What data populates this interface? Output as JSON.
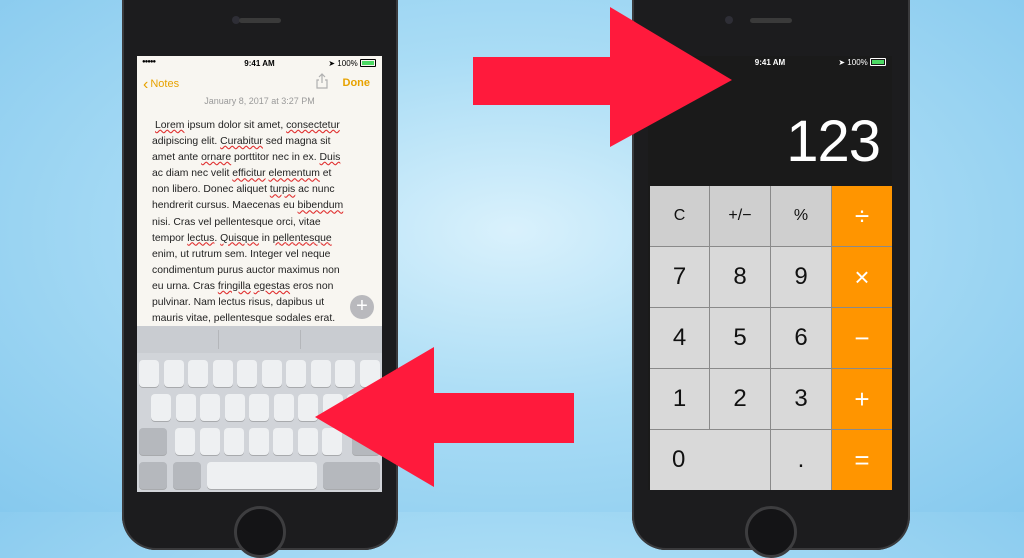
{
  "notes": {
    "status": {
      "time": "9:41 AM",
      "battery": "100%"
    },
    "nav": {
      "back_label": "Notes",
      "done_label": "Done"
    },
    "date": "January 8, 2017 at 3:27 PM",
    "lines": [
      [
        "Lorem",
        " ipsum dolor sit amet, ",
        "consectetur"
      ],
      [
        "adipiscing elit. ",
        "Curabitur",
        " sed magna sit"
      ],
      [
        "amet ante ",
        "ornare",
        " porttitor nec in ex. ",
        "Duis"
      ],
      [
        "ac diam nec velit ",
        "efficitur",
        " ",
        "elementum",
        " et"
      ],
      [
        "non libero. Donec aliquet ",
        "turpis",
        " ac nunc"
      ],
      [
        "hendrerit cursus. Maecenas eu ",
        "bibendum"
      ],
      [
        "nisi. Cras vel pellentesque orci, vitae"
      ],
      [
        "tempor ",
        "lectus",
        ". ",
        "Quisque",
        " in ",
        "pellentesque"
      ],
      [
        "enim, ut rutrum sem. Integer vel neque"
      ],
      [
        "condimentum purus auctor maximus non"
      ],
      [
        "eu urna. Cras ",
        "fringilla",
        " ",
        "egestas",
        " eros non"
      ],
      [
        "pulvinar. Nam lectus risus, dapibus ut"
      ],
      [
        "mauris vitae, pellentesque sodales erat."
      ]
    ],
    "underlined_words": [
      "Lorem",
      "consectetur",
      "Curabitur",
      "ornare",
      "Duis",
      "efficitur",
      "elementum",
      "turpis",
      "bibendum",
      "lectus",
      "Quisque",
      "pellentesque",
      "fringilla",
      "egestas"
    ]
  },
  "calculator": {
    "status": {
      "time": "9:41 AM",
      "battery": "100%"
    },
    "display": "123",
    "keys": {
      "clear": "C",
      "sign": "+/−",
      "percent": "%",
      "divide": "÷",
      "seven": "7",
      "eight": "8",
      "nine": "9",
      "multiply": "×",
      "four": "4",
      "five": "5",
      "six": "6",
      "minus": "−",
      "one": "1",
      "two": "2",
      "three": "3",
      "plus": "+",
      "zero": "0",
      "decimal": ".",
      "equals": "="
    }
  },
  "colors": {
    "arrow": "#ff1a3c",
    "calc_operator": "#ff9500",
    "notes_accent": "#e7a200"
  }
}
